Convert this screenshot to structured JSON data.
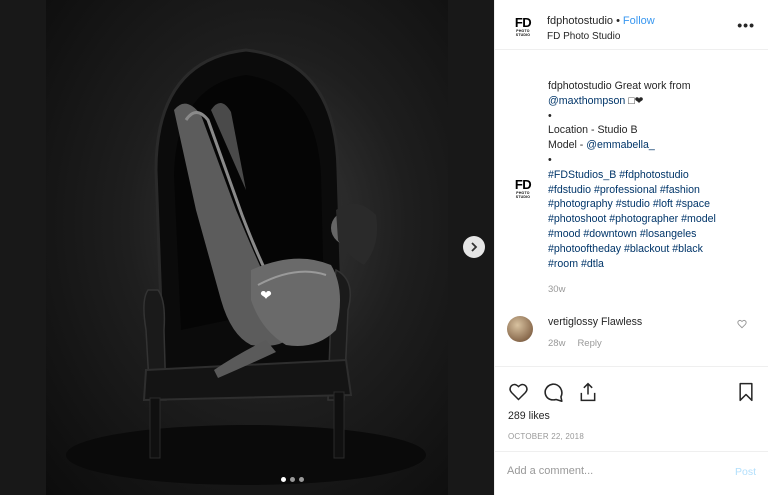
{
  "post": {
    "username": "fdphotostudio",
    "separator": "•",
    "follow_label": "Follow",
    "account_subtitle": "FD Photo Studio",
    "more_label": "•••",
    "logo_text": "FD",
    "logo_sub_text": "PHOTO STUDIO"
  },
  "caption": {
    "author": "fdphotostudio",
    "text": "Great work from",
    "mention": "@maxthompson",
    "emoji": "□❤",
    "bullet1": "•",
    "location": "Location - Studio B",
    "model_prefix": "Model - ",
    "model_mention": "@emmabella_",
    "bullet2": "•",
    "hashtags": [
      "#FDStudios_B #fdphotostudio",
      "#fdstudio #professional #fashion",
      "#photography #studio #loft #space",
      "#photoshoot #photographer #model",
      "#mood #downtown #losangeles",
      "#photooftheday #blackout #black",
      "#room #dtla"
    ],
    "age": "30w"
  },
  "comment": {
    "author": "vertiglossy",
    "text": "Flawless",
    "age": "28w",
    "reply_label": "Reply"
  },
  "actions": {
    "likes": "289 likes",
    "date": "OCTOBER 22, 2018",
    "like_icon": "heart-icon",
    "comment_icon": "comment-icon",
    "share_icon": "share-icon",
    "save_icon": "bookmark-icon"
  },
  "add_comment": {
    "placeholder": "Add a comment...",
    "post_label": "Post"
  },
  "carousel": {
    "dot_count": 3,
    "active_dot": 1
  },
  "colors": {
    "link": "#003569",
    "follow": "#3897f0",
    "muted": "#999999",
    "post_disabled": "#b2dffc"
  }
}
